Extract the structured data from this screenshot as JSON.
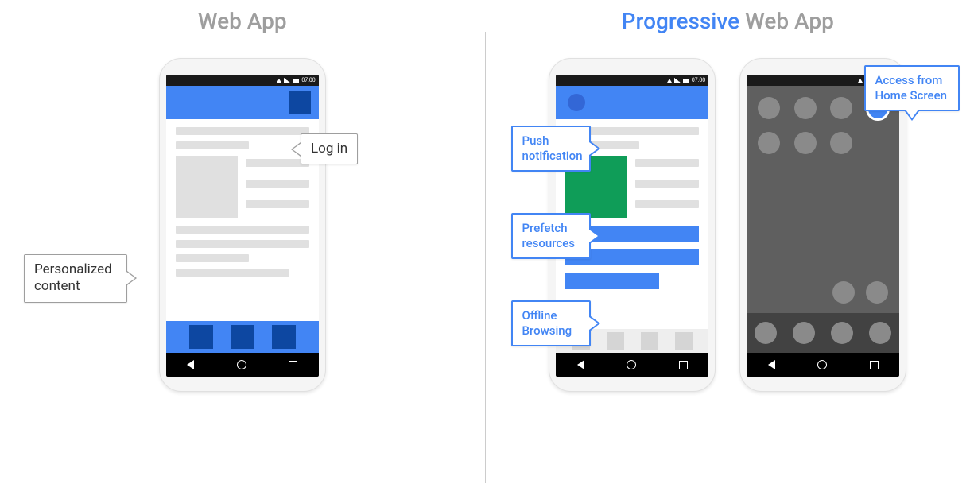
{
  "left": {
    "heading": "Web App",
    "callouts": {
      "login": "Log in",
      "personalized": "Personalized content"
    },
    "status_time": "07:00"
  },
  "right": {
    "heading_accent": "Progressive",
    "heading_rest": " Web App",
    "callouts": {
      "push": "Push notification",
      "prefetch": "Prefetch resources",
      "offline": "Offline Browsing",
      "homescreen": "Access from Home Screen"
    },
    "status_time": "07:00"
  }
}
